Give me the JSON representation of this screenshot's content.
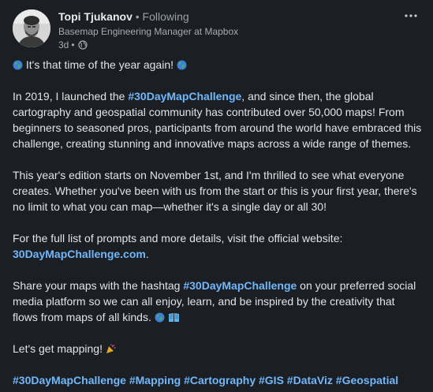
{
  "post": {
    "author": {
      "name": "Topi Tjukanov",
      "separator": "•",
      "follow_status": "Following",
      "headline": "Basemap Engineering Manager at Mapbox",
      "time": "3d",
      "meta_separator": "•",
      "visibility_icon": "globe-icon"
    },
    "more_icon": "more-horizontal-icon",
    "intro": {
      "text": "It's that time of the year again!",
      "emoji": "globe-emoji"
    },
    "paragraph1": {
      "part1": "In 2019, I launched the ",
      "hashtag1": "#30DayMapChallenge",
      "part2": ", and since then, the global cartography and geospatial community has contributed over 50,000 maps! From beginners to seasoned pros, participants from around the world have embraced this challenge, creating stunning and innovative maps across a wide range of themes."
    },
    "paragraph2": {
      "text": "This year's edition starts on November 1st, and I'm thrilled to see what everyone creates. Whether you've been with us from the start or this is your first year, there's no limit to what you can map—whether it's a single day or all 30!"
    },
    "paragraph3": {
      "part1": "For the full list of prompts and more details, visit the official website: ",
      "link": "30DayMapChallenge.com",
      "part2": "."
    },
    "paragraph4": {
      "part1": "Share your maps with the hashtag ",
      "hashtag": "#30DayMapChallenge",
      "part2": " on your preferred social media platform so we can all enjoy, learn, and be inspired by the creativity that flows from maps of all kinds.",
      "emojis": [
        "globe-emoji",
        "map-book-emoji"
      ]
    },
    "paragraph5": {
      "text": "Let's get mapping!",
      "emoji": "party-popper-emoji"
    },
    "hashtags": [
      "#30DayMapChallenge",
      "#Mapping",
      "#Cartography",
      "#GIS",
      "#DataViz",
      "#Geospatial"
    ],
    "colors": {
      "background": "#1b1f23",
      "text": "#e1e4e6",
      "muted": "#a7abb0",
      "link": "#71b7fb"
    }
  }
}
